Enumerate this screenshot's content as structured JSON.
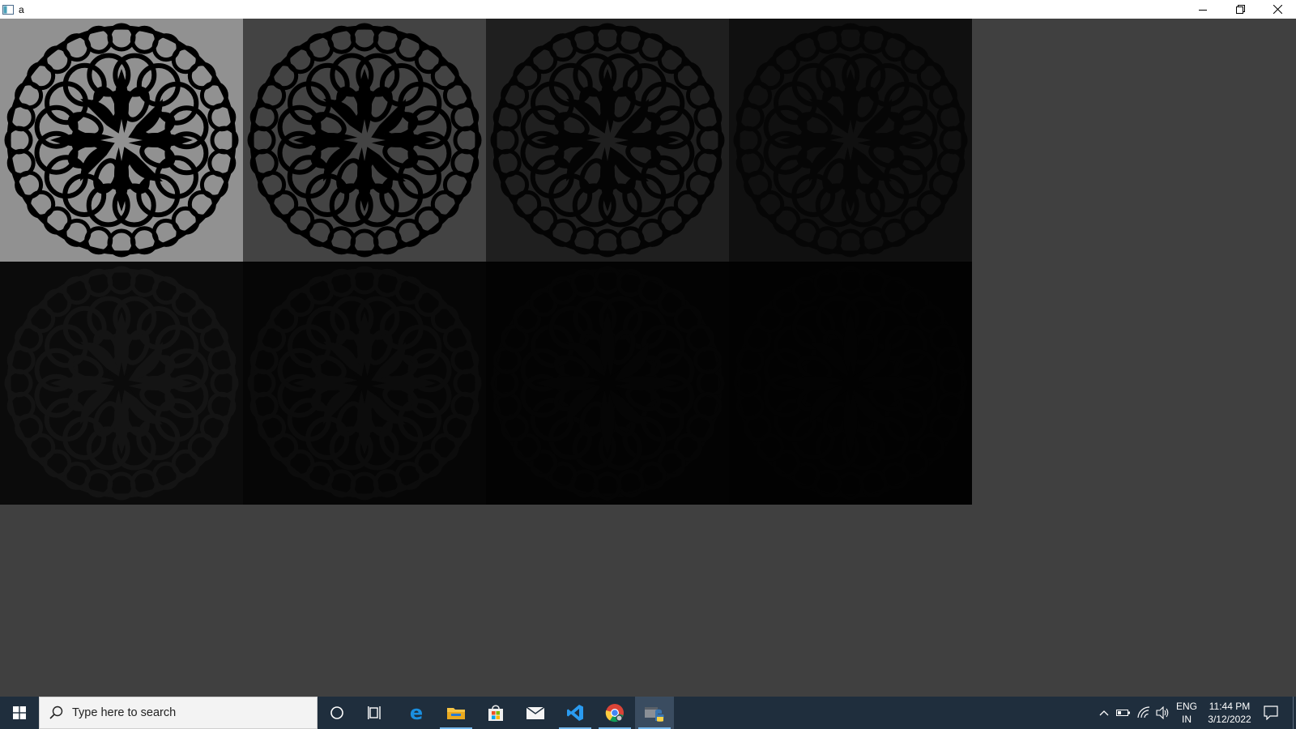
{
  "window": {
    "title": "a",
    "controls": [
      "minimize",
      "restore",
      "close"
    ]
  },
  "grid": {
    "panels": [
      {
        "index": 1,
        "background": "#919191",
        "ink": "#000000",
        "opacity": 1.0
      },
      {
        "index": 2,
        "background": "#434343",
        "ink": "#000000",
        "opacity": 1.0
      },
      {
        "index": 3,
        "background": "#1f1f1f",
        "ink": "#000000",
        "opacity": 0.85
      },
      {
        "index": 4,
        "background": "#101010",
        "ink": "#000000",
        "opacity": 0.6
      },
      {
        "index": 5,
        "background": "#0b0b0b",
        "ink": "#1a1a1a",
        "opacity": 0.6
      },
      {
        "index": 6,
        "background": "#060606",
        "ink": "#141414",
        "opacity": 0.45
      },
      {
        "index": 7,
        "background": "#030303",
        "ink": "#0a0a0a",
        "opacity": 0.3
      },
      {
        "index": 8,
        "background": "#020202",
        "ink": "#070707",
        "opacity": 0.2
      }
    ]
  },
  "taskbar": {
    "search_placeholder": "Type here to search",
    "apps": [
      {
        "name": "cortana-icon"
      },
      {
        "name": "task-view-icon"
      },
      {
        "name": "edge-icon"
      },
      {
        "name": "file-explorer-icon"
      },
      {
        "name": "store-icon"
      },
      {
        "name": "mail-icon"
      },
      {
        "name": "vscode-icon"
      },
      {
        "name": "chrome-icon"
      },
      {
        "name": "python-icon"
      }
    ],
    "tray": {
      "language_line1": "ENG",
      "language_line2": "IN",
      "time": "11:44 PM",
      "date": "3/12/2022"
    }
  },
  "colors": {
    "desktop": "#404040",
    "taskbar": "#1f2e3d",
    "accent_underline": "#76b9ed"
  }
}
